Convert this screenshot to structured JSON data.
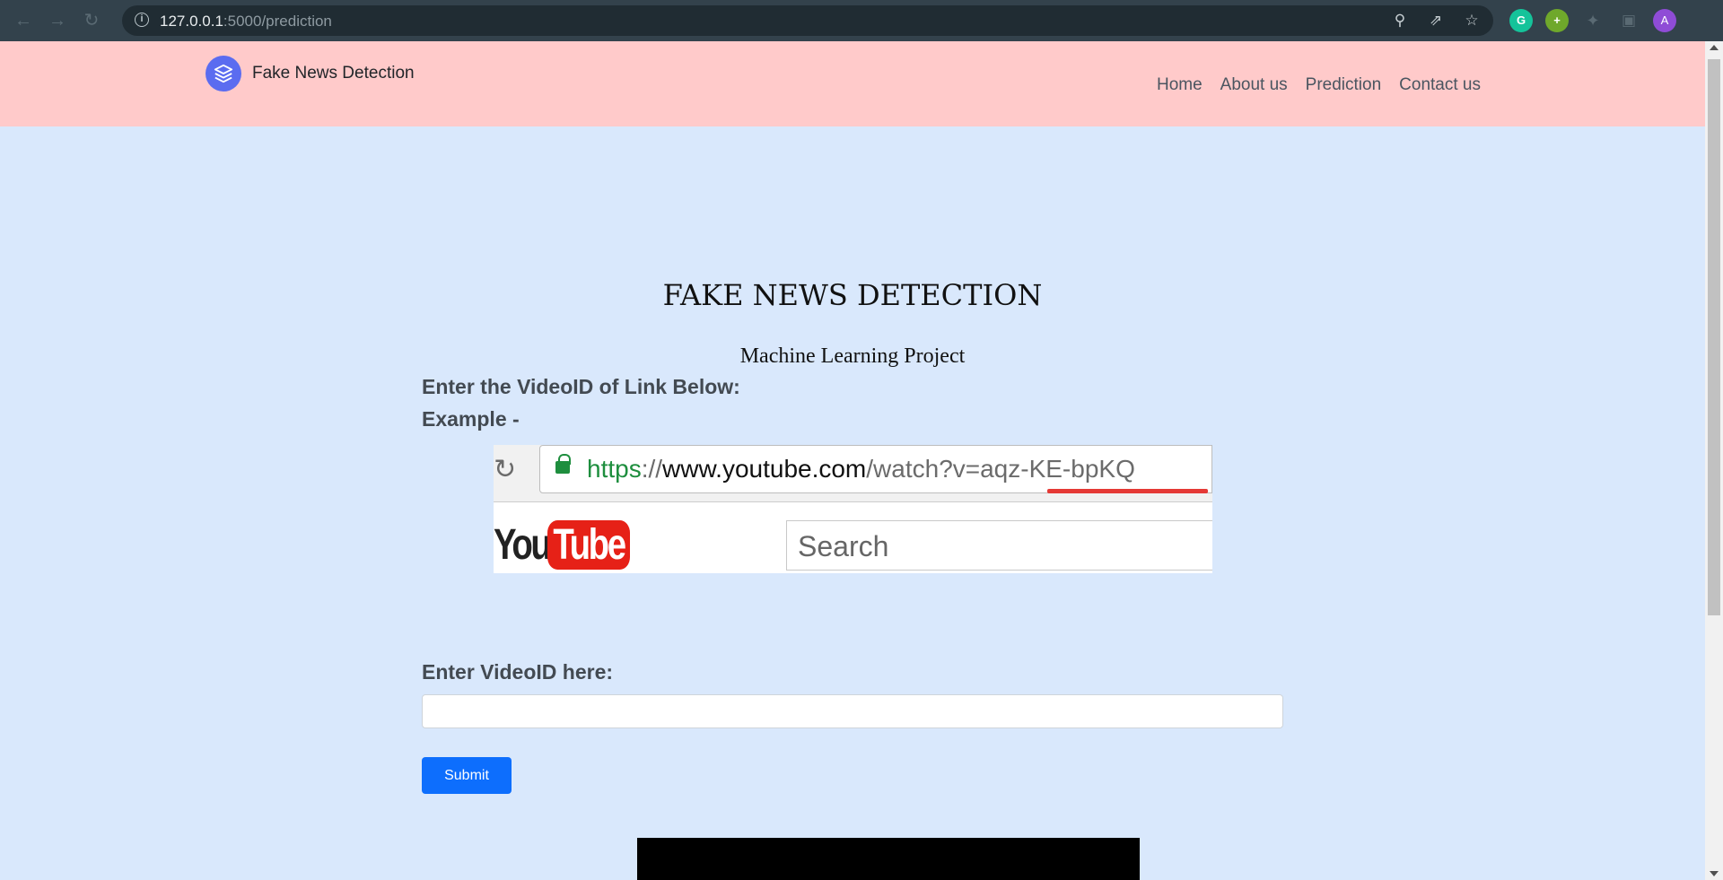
{
  "browser": {
    "url_host": "127.0.0.1",
    "url_path": ":5000/prediction",
    "avatar_letter": "A"
  },
  "navbar": {
    "brand": "Fake News Detection",
    "links": [
      "Home",
      "About us",
      "Prediction",
      "Contact us"
    ]
  },
  "hero": {
    "title": "FAKE NEWS DETECTION",
    "subtitle": "Machine Learning Project"
  },
  "form": {
    "instruction": "Enter the VideoID of Link Below:",
    "example_label": "Example -",
    "videoid_label": "Enter VideoID here:",
    "videoid_value": "",
    "submit_label": "Submit"
  },
  "example_image": {
    "url_scheme": "https",
    "url_sep": "://",
    "url_host": "www.youtube.com",
    "url_rest": "/watch?v=aqz-KE-bpKQ",
    "logo_you": "You",
    "logo_tube": "Tube",
    "search_placeholder": "Search"
  },
  "colors": {
    "navbar_bg": "#ffcaca",
    "page_bg": "#d9e8fc",
    "submit_bg": "#0d6efd",
    "brand_logo": "#5b6cf0"
  }
}
